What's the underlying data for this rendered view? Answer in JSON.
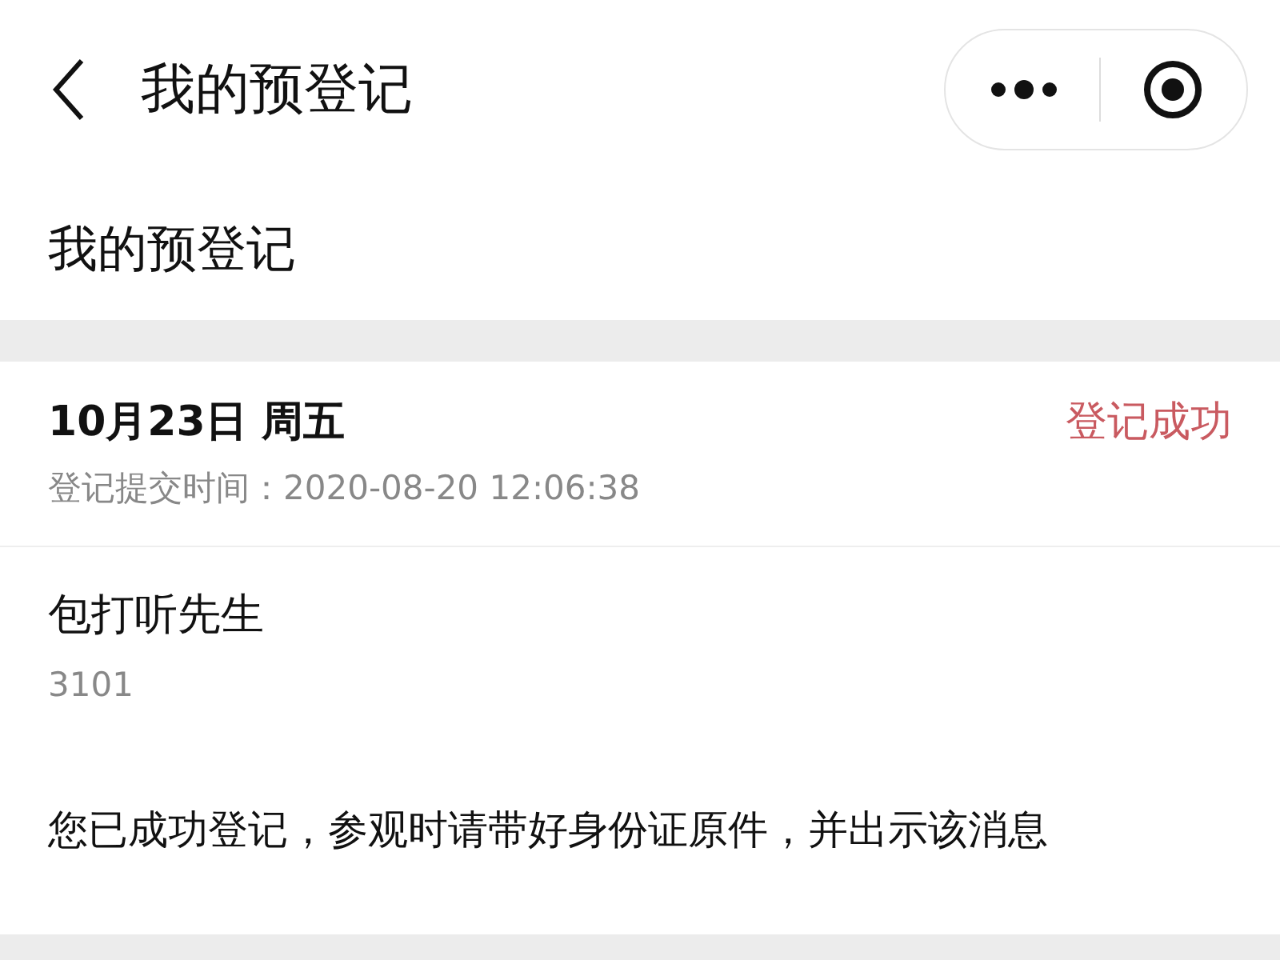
{
  "nav_bar": {
    "title": "我的预登记"
  },
  "page_heading": "我的预登记",
  "registration": {
    "date": "10月23日 周五",
    "status": "登记成功",
    "submitted": "登记提交时间：2020-08-20 12:06:38",
    "name": "包打听先生",
    "code": "3101",
    "message": "您已成功登记，参观时请带好身份证原件，并出示该消息"
  }
}
